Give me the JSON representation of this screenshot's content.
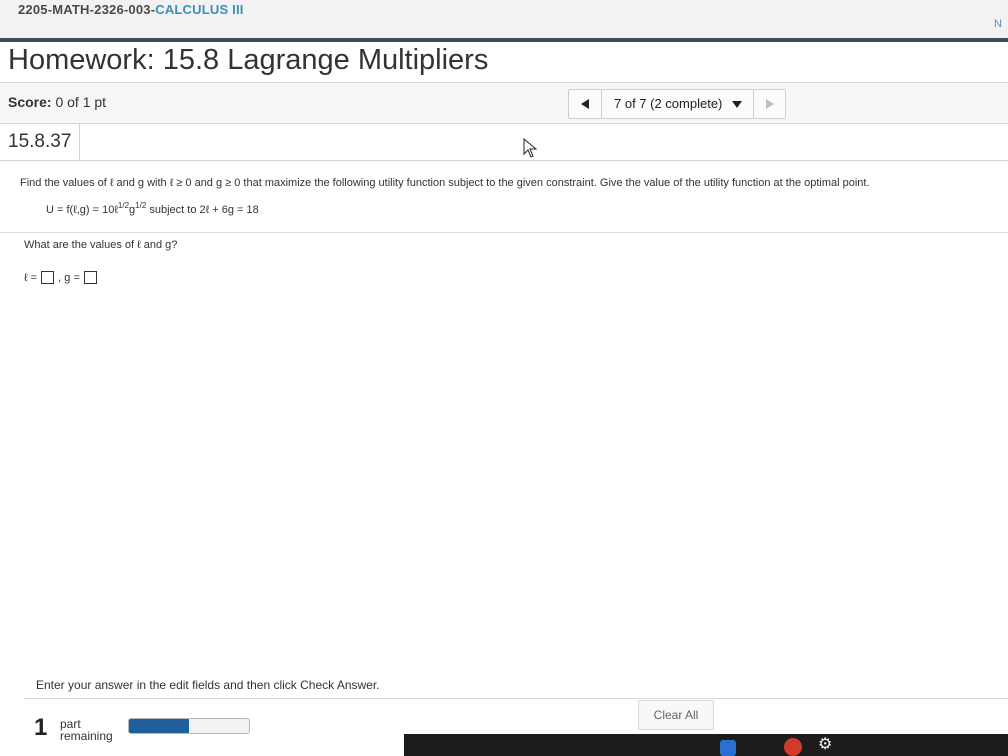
{
  "course": {
    "title_prefix": "2205-MATH-2326-003-",
    "title_suffix": "CALCULUS III",
    "corner_letter": "N"
  },
  "homework": {
    "title": "Homework: 15.8 Lagrange Multipliers"
  },
  "score": {
    "label": "Score:",
    "value": "0 of 1 pt"
  },
  "navigation": {
    "prev_icon": "triangle-left-icon",
    "selected": "7 of 7 (2 complete)",
    "dropdown_icon": "caret-down-icon",
    "next_icon": "triangle-right-icon"
  },
  "question": {
    "id": "15.8.37",
    "text": "Find the values of ℓ and g with ℓ ≥ 0 and g ≥ 0 that maximize the following utility function subject to the given constraint. Give the value of the utility function at the optimal point.",
    "formula_base": "U = f(ℓ,g) = 10ℓ",
    "formula_exp1": "1/2",
    "formula_g": "g",
    "formula_exp2": "1/2",
    "formula_constraint": "subject to 2ℓ + 6g = 18",
    "prompt": "What are the values of ℓ and g?",
    "answer_l_label": "ℓ =",
    "answer_separator": ", g =",
    "answer_l_value": "",
    "answer_g_value": ""
  },
  "footer": {
    "instruction": "Enter your answer in the edit fields and then click Check Answer.",
    "clear_all": "Clear All",
    "parts_remaining_count": "1",
    "parts_remaining_line1": "part",
    "parts_remaining_line2": "remaining",
    "progress_fraction": 0.5
  },
  "colors": {
    "accent": "#1f5f9a",
    "header_rule": "#3c4c5a"
  }
}
